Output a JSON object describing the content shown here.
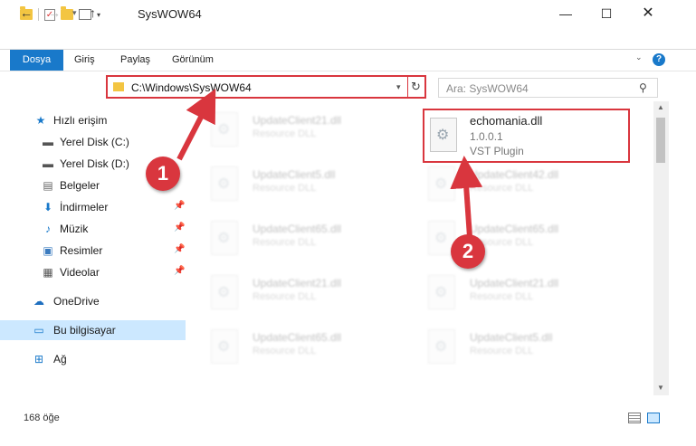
{
  "window": {
    "title": "SysWOW64",
    "minimize": "—",
    "maximize": "☐",
    "close": "✕"
  },
  "ribbon": {
    "tabs": [
      "Dosya",
      "Giriş",
      "Paylaş",
      "Görünüm"
    ],
    "help": "?"
  },
  "nav": {
    "address": "C:\\Windows\\SysWOW64",
    "search_placeholder": "Ara: SysWOW64"
  },
  "sidebar": {
    "items": [
      {
        "label": "Hızlı erişim",
        "icon": "star-icon"
      },
      {
        "label": "Yerel Disk (C:)",
        "icon": "drive-icon"
      },
      {
        "label": "Yerel Disk (D:)",
        "icon": "drive-icon"
      },
      {
        "label": "Belgeler",
        "icon": "documents-icon"
      },
      {
        "label": "İndirmeler",
        "icon": "download-icon"
      },
      {
        "label": "Müzik",
        "icon": "music-icon"
      },
      {
        "label": "Resimler",
        "icon": "pictures-icon"
      },
      {
        "label": "Videolar",
        "icon": "video-icon"
      },
      {
        "label": "OneDrive",
        "icon": "cloud-icon"
      },
      {
        "label": "Bu bilgisayar",
        "icon": "computer-icon"
      },
      {
        "label": "Ağ",
        "icon": "network-icon"
      }
    ]
  },
  "files": [
    {
      "name": "UpdateClient21.dll",
      "type": "Resource DLL"
    },
    {
      "name": "echomania.dll",
      "type": "1.0.0.1",
      "extra": "VST Plugin"
    },
    {
      "name": "UpdateClient5.dll",
      "type": "Resource DLL"
    },
    {
      "name": "UpdateClient42.dll",
      "type": "Resource DLL"
    },
    {
      "name": "UpdateClient65.dll",
      "type": "Resource DLL"
    },
    {
      "name": "UpdateClient65.dll",
      "type": "Resource DLL"
    },
    {
      "name": "UpdateClient21.dll",
      "type": "Resource DLL"
    },
    {
      "name": "UpdateClient21.dll",
      "type": "Resource DLL"
    },
    {
      "name": "UpdateClient65.dll",
      "type": "Resource DLL"
    },
    {
      "name": "UpdateClient5.dll",
      "type": "Resource DLL"
    }
  ],
  "status": {
    "count": "168 öğe"
  },
  "callouts": [
    "1",
    "2"
  ],
  "colors": {
    "accent": "#1979ca",
    "highlight": "#d9363e",
    "selected_bg": "#cce8ff"
  }
}
